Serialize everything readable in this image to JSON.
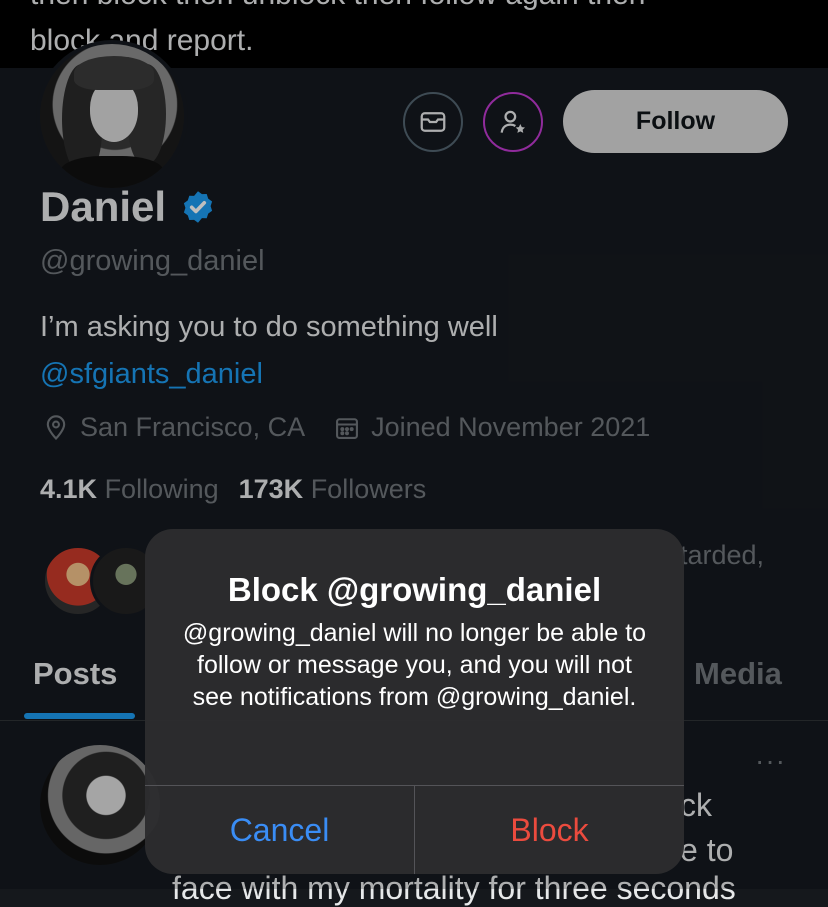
{
  "top_tweet": {
    "line1": "then block then unblock then follow again then",
    "line2": "block and report."
  },
  "profile": {
    "name": "Daniel",
    "handle": "@growing_daniel",
    "bio": "I’m asking you to do something well",
    "bio_link": "@sfgiants_daniel",
    "location": "San Francisco, CA",
    "joined": "Joined November 2021",
    "following_count": "4.1K",
    "following_label": "Following",
    "followers_count": "173K",
    "followers_label": "Followers",
    "followers_you_know_fragment": "tarded,"
  },
  "actions": {
    "follow_label": "Follow"
  },
  "tabs": [
    {
      "label": "Posts"
    },
    {
      "label": "Media"
    }
  ],
  "post": {
    "more": "···",
    "frag1": "ck",
    "frag2": "e to",
    "frag3": "face with my mortality for three seconds"
  },
  "modal": {
    "title": "Block @growing_daniel",
    "message": "@growing_daniel will no longer be able to follow or message you, and you will not see notifications from @growing_daniel.",
    "cancel_label": "Cancel",
    "block_label": "Block"
  },
  "colors": {
    "accent": "#1d9bf0",
    "cancel": "#3a8df5",
    "block": "#eb4b3e",
    "background": "#15191f"
  }
}
